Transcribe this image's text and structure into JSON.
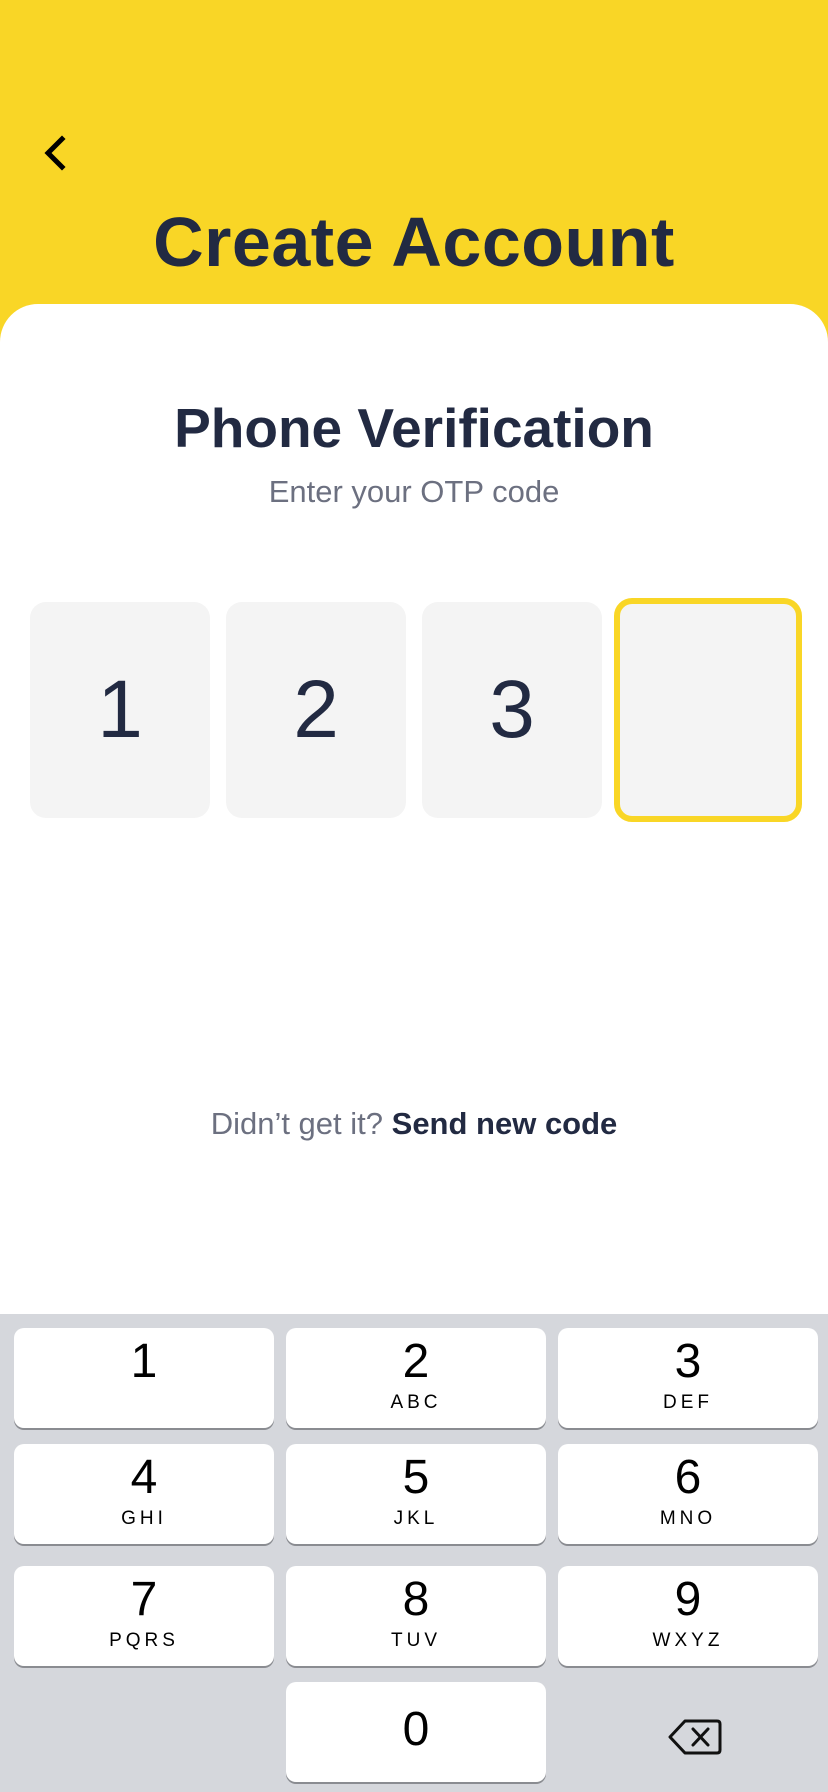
{
  "header": {
    "title": "Create Account",
    "back_icon": "chevron-left-icon"
  },
  "verification": {
    "title": "Phone Verification",
    "subtitle": "Enter your OTP code",
    "otp_digits": [
      "1",
      "2",
      "3",
      ""
    ],
    "resend_prompt": "Didn’t get it?",
    "resend_link": "Send new code"
  },
  "keypad": {
    "keys": [
      {
        "digit": "1",
        "letters": ""
      },
      {
        "digit": "2",
        "letters": "ABC"
      },
      {
        "digit": "3",
        "letters": "DEF"
      },
      {
        "digit": "4",
        "letters": "GHI"
      },
      {
        "digit": "5",
        "letters": "JKL"
      },
      {
        "digit": "6",
        "letters": "MNO"
      },
      {
        "digit": "7",
        "letters": "PQRS"
      },
      {
        "digit": "8",
        "letters": "TUV"
      },
      {
        "digit": "9",
        "letters": "WXYZ"
      },
      {
        "digit": "0",
        "letters": ""
      }
    ],
    "delete_icon": "backspace-icon"
  },
  "colors": {
    "accent": "#F9D626",
    "text_dark": "#222A42",
    "text_muted": "#6C7080",
    "keypad_bg": "#D5D7DC"
  }
}
